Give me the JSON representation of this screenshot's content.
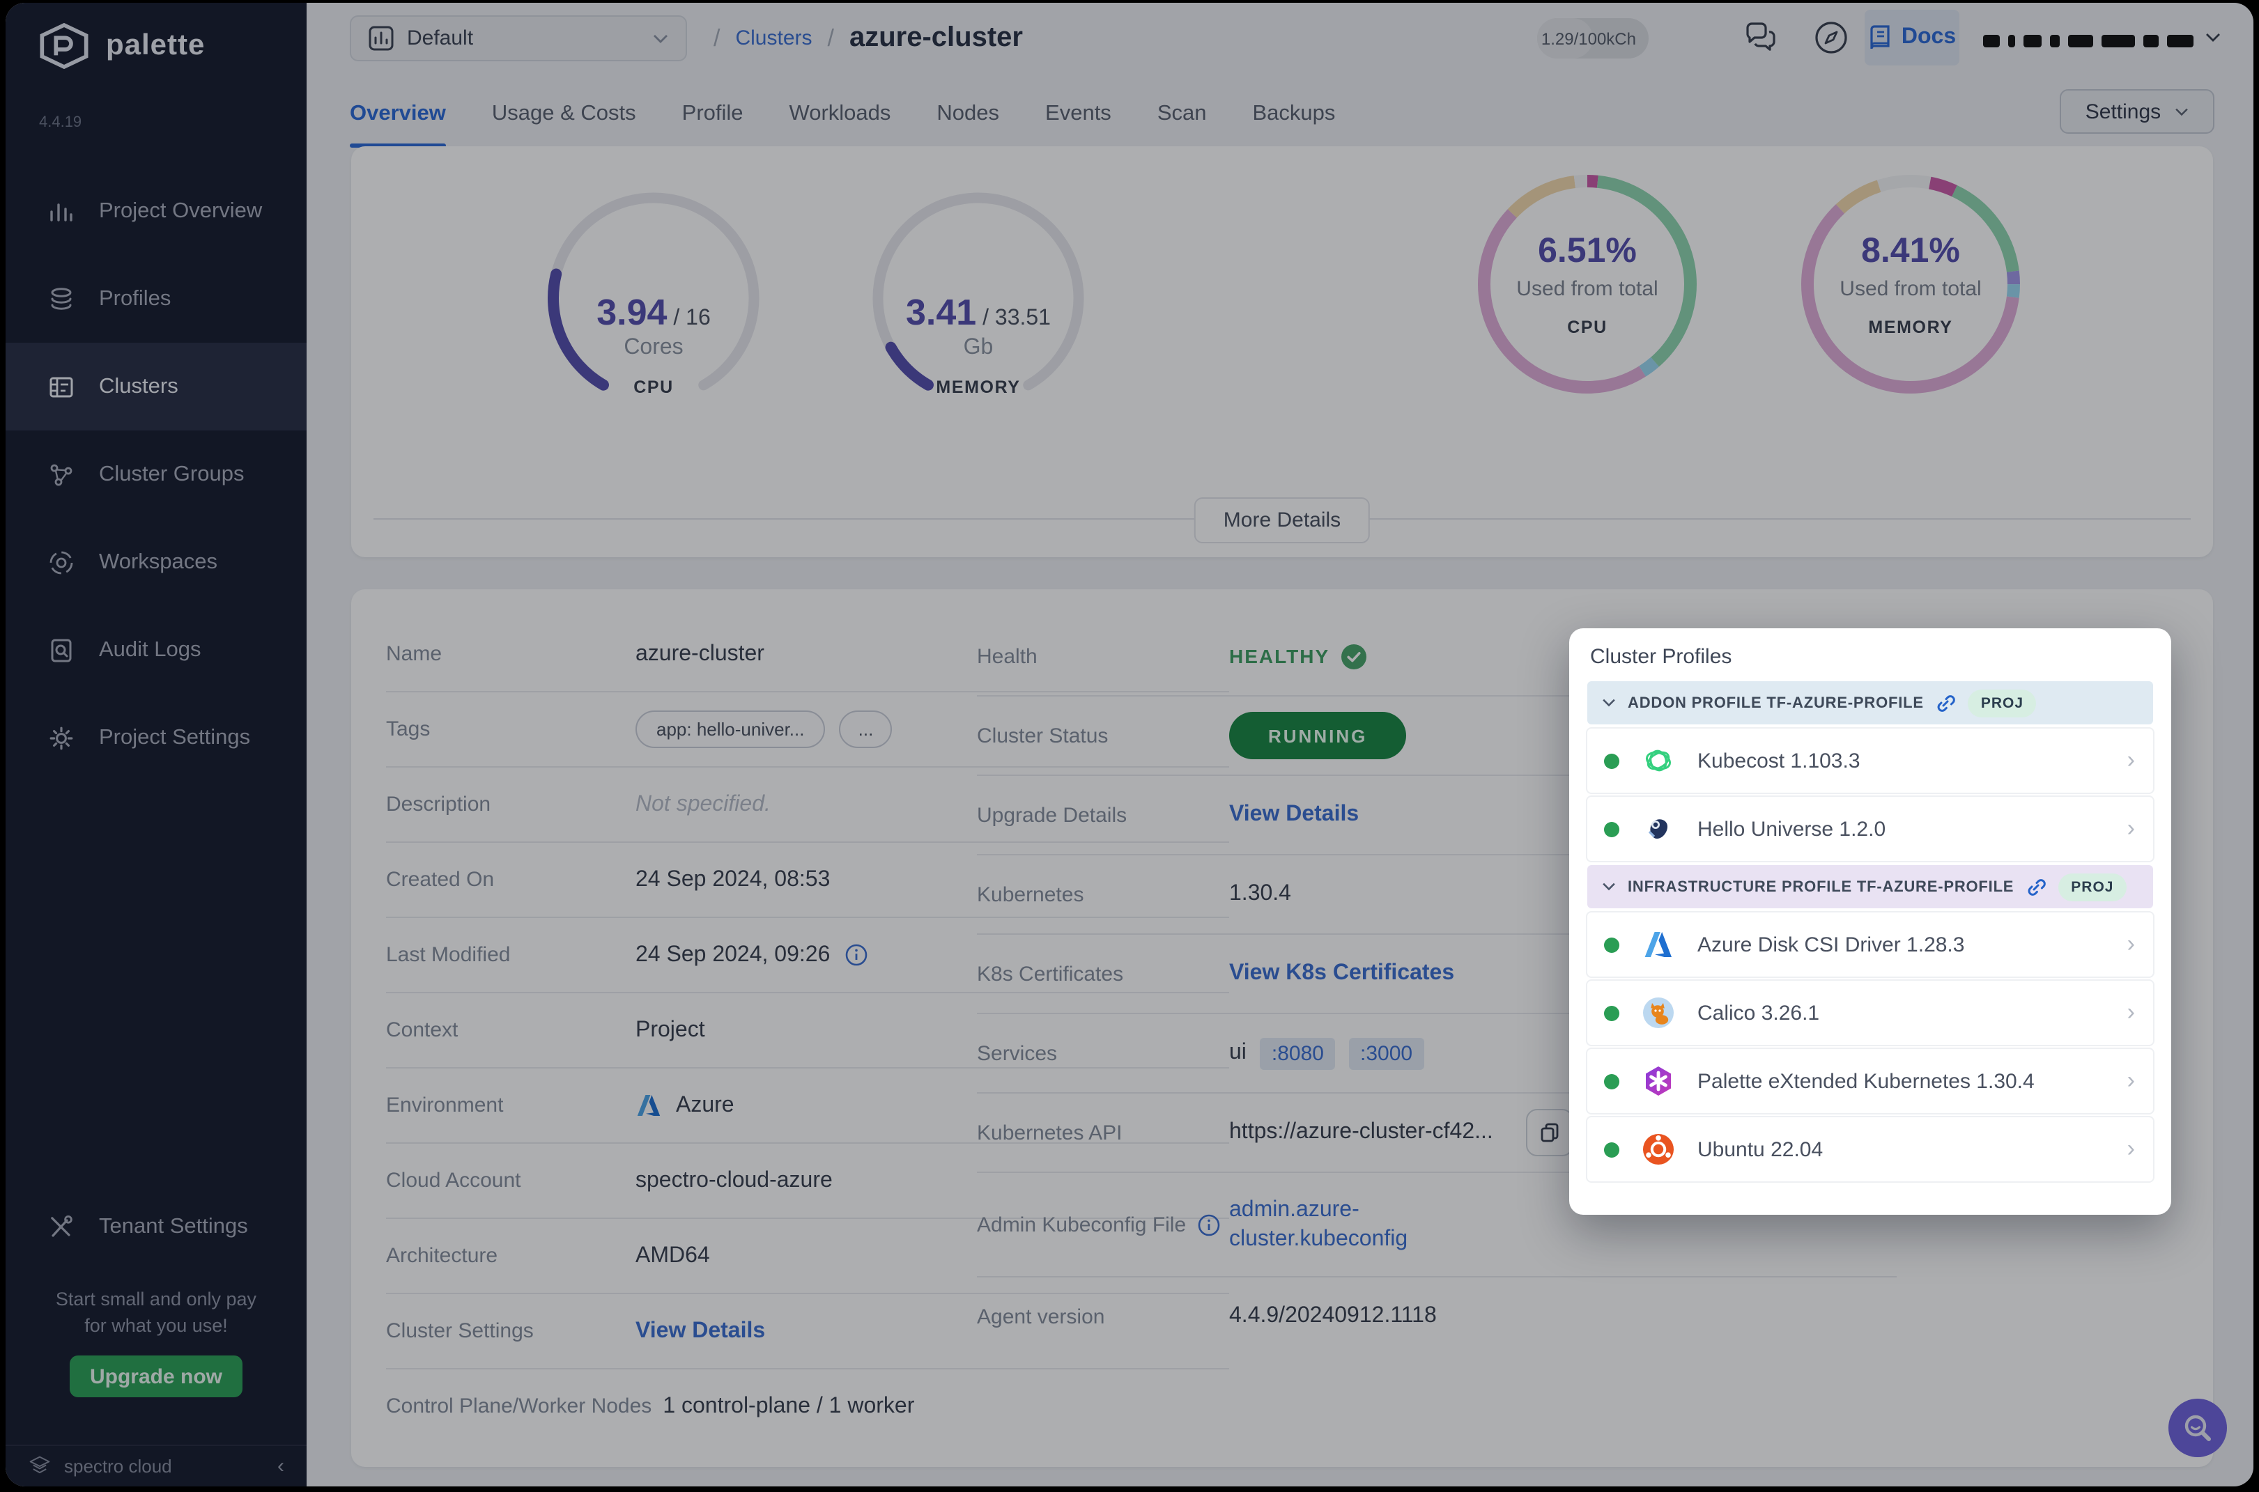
{
  "sidebar": {
    "brand": "palette",
    "version": "4.4.19",
    "items": [
      {
        "label": "Project Overview",
        "icon": "bar-chart-icon"
      },
      {
        "label": "Profiles",
        "icon": "layers-icon"
      },
      {
        "label": "Clusters",
        "icon": "cluster-list-icon"
      },
      {
        "label": "Cluster Groups",
        "icon": "nodes-icon"
      },
      {
        "label": "Workspaces",
        "icon": "workspaces-icon"
      },
      {
        "label": "Audit Logs",
        "icon": "audit-search-icon"
      },
      {
        "label": "Project Settings",
        "icon": "gear-icon"
      }
    ],
    "tenant_settings": "Tenant Settings",
    "promo_line1": "Start small and only pay",
    "promo_line2": "for what you use!",
    "upgrade_label": "Upgrade now",
    "footer_brand": "spectro cloud"
  },
  "topbar": {
    "project": "Default",
    "sep": "/",
    "breadcrumb_root": "Clusters",
    "breadcrumb_current": "azure-cluster",
    "usage": "1.29/100kCh",
    "docs": "Docs"
  },
  "tabs": {
    "items": [
      "Overview",
      "Usage & Costs",
      "Profile",
      "Workloads",
      "Nodes",
      "Events",
      "Scan",
      "Backups"
    ],
    "settings": "Settings"
  },
  "overview": {
    "gauges": [
      {
        "value": "3.94",
        "total": " / 16",
        "unit": "Cores",
        "metric": "CPU",
        "fraction": 0.246
      },
      {
        "value": "3.41",
        "total": " / 33.51",
        "unit": "Gb",
        "metric": "MEMORY",
        "fraction": 0.102
      }
    ],
    "donuts": [
      {
        "pct": "6.51%",
        "caption": "Used from total",
        "metric": "CPU",
        "segments": [
          [
            "#c95ba8",
            1.6
          ],
          [
            "#8fd6b0",
            37
          ],
          [
            "#9cd8f2",
            2.4
          ],
          [
            "#e0aed8",
            46
          ],
          [
            "#f2d9ae",
            11
          ],
          [
            "#f4f5f7",
            2
          ]
        ]
      },
      {
        "pct": "8.41%",
        "caption": "Used from total",
        "metric": "MEMORY",
        "segments": [
          [
            "#f4f5f7",
            3
          ],
          [
            "#c95ba8",
            4
          ],
          [
            "#8fd6b0",
            16
          ],
          [
            "#a198e8",
            2
          ],
          [
            "#9cd8f2",
            2
          ],
          [
            "#e0aed8",
            61
          ],
          [
            "#f2d9ae",
            7
          ],
          [
            "#f4f5f7",
            5
          ]
        ]
      }
    ],
    "more_details": "More Details"
  },
  "details_left": {
    "rows": [
      {
        "label": "Name",
        "value": "azure-cluster"
      },
      {
        "label": "Tags",
        "tag": "app: hello-univer...",
        "more": "..."
      },
      {
        "label": "Description",
        "value": "Not specified."
      },
      {
        "label": "Created On",
        "value": "24 Sep 2024, 08:53"
      },
      {
        "label": "Last Modified",
        "value": "24 Sep 2024, 09:26"
      },
      {
        "label": "Context",
        "value": "Project"
      },
      {
        "label": "Environment",
        "value": "Azure"
      },
      {
        "label": "Cloud Account",
        "value": "spectro-cloud-azure"
      },
      {
        "label": "Architecture",
        "value": "AMD64"
      },
      {
        "label": "Cluster Settings",
        "link": "View Details"
      },
      {
        "label": "Control Plane/Worker Nodes",
        "value": "1 control-plane / 1 worker"
      }
    ]
  },
  "details_right": {
    "rows": [
      {
        "label": "Health",
        "value": "HEALTHY"
      },
      {
        "label": "Cluster Status",
        "value": "RUNNING"
      },
      {
        "label": "Upgrade Details",
        "link": "View Details"
      },
      {
        "label": "Kubernetes",
        "value": "1.30.4"
      },
      {
        "label": "K8s Certificates",
        "link": "View K8s Certificates"
      },
      {
        "label": "Services",
        "prefix": "ui",
        "port1": ":8080",
        "port2": ":3000"
      },
      {
        "label": "Kubernetes API",
        "value": "https://azure-cluster-cf42..."
      },
      {
        "label": "Admin Kubeconfig File",
        "link_line1": "admin.azure-",
        "link_line2": "cluster.kubeconfig"
      },
      {
        "label": "Agent version",
        "value": "4.4.9/20240912.1118"
      }
    ]
  },
  "popup": {
    "title": "Cluster Profiles",
    "sections": [
      {
        "label": "ADDON PROFILE TF-AZURE-PROFILE",
        "badge": "PROJ",
        "items": [
          {
            "name": "Kubecost 1.103.3",
            "icon": "kubecost-icon"
          },
          {
            "name": "Hello Universe 1.2.0",
            "icon": "hello-universe-icon"
          }
        ]
      },
      {
        "label": "INFRASTRUCTURE PROFILE TF-AZURE-PROFILE",
        "badge": "PROJ",
        "items": [
          {
            "name": "Azure Disk CSI Driver 1.28.3",
            "icon": "azure-icon"
          },
          {
            "name": "Calico 3.26.1",
            "icon": "calico-icon"
          },
          {
            "name": "Palette eXtended Kubernetes 1.30.4",
            "icon": "pxk-icon"
          },
          {
            "name": "Ubuntu 22.04",
            "icon": "ubuntu-icon"
          }
        ]
      }
    ]
  },
  "colors": {
    "accent_blue": "#2e6bd6",
    "link_blue": "#3d6fd0",
    "running_green": "#1b8745",
    "healthy_green": "#3f9e63",
    "gauge_purple": "#564fae",
    "sidebar_bg": "#191e30",
    "upgrade_green": "#2ea158",
    "fab_purple": "#7064dd"
  }
}
